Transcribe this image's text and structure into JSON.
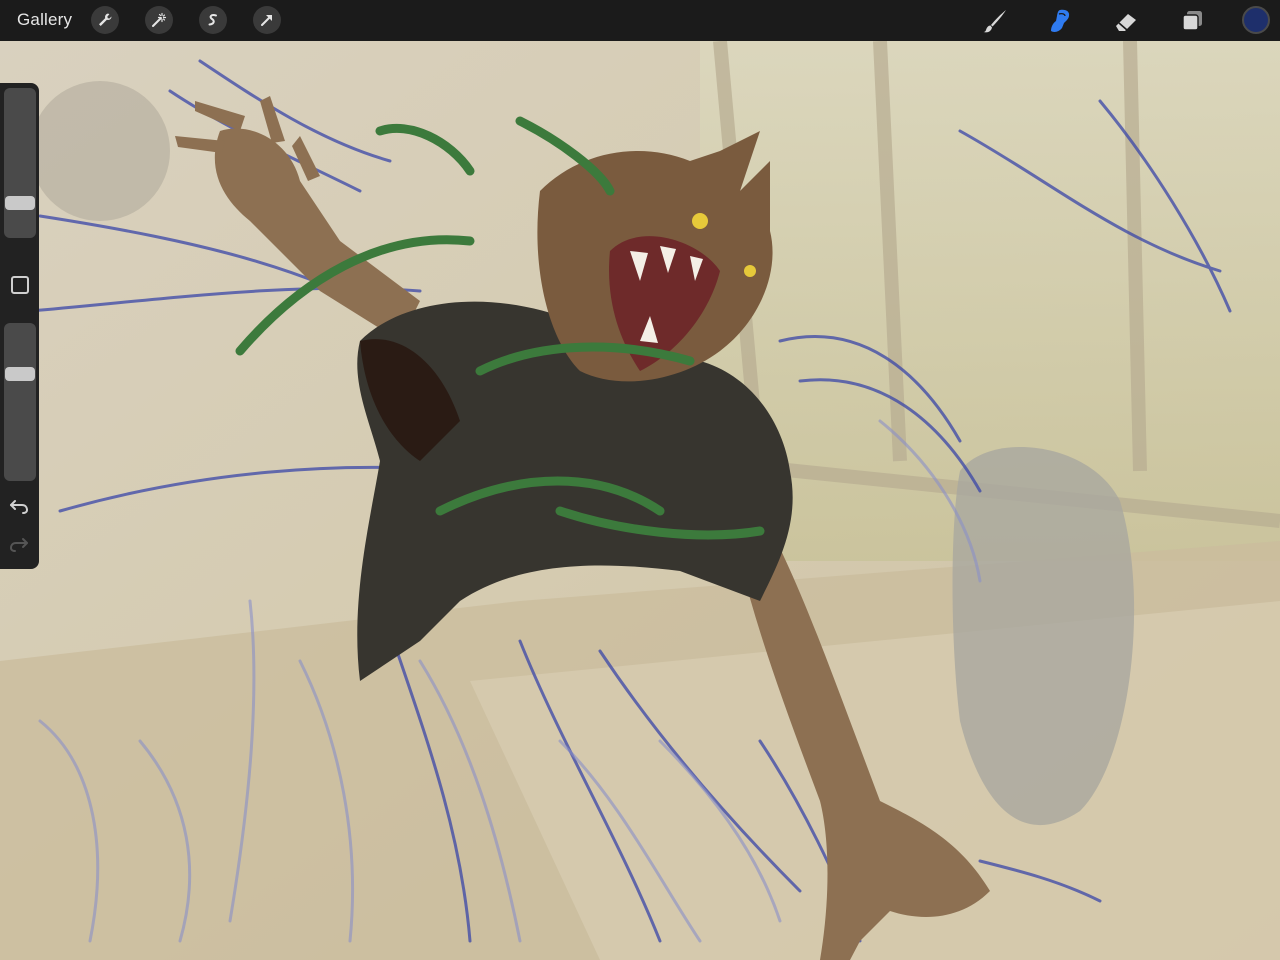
{
  "toolbar": {
    "gallery_label": "Gallery",
    "left_tools": [
      "wrench-icon",
      "magic-wand-icon",
      "selection-icon",
      "transform-arrow-icon"
    ],
    "right_tools": [
      "brush-icon",
      "smudge-icon",
      "eraser-icon",
      "layers-icon"
    ],
    "active_tool": "smudge-icon",
    "active_color": "#1e2f6b",
    "accent_color": "#2f7bf0"
  },
  "sidebar": {
    "brush_size_level": 0.2,
    "opacity_level": 0.7,
    "controls": [
      "modify-button",
      "undo-icon",
      "redo-icon"
    ]
  },
  "canvas": {
    "subject": "werewolf-illustration"
  }
}
